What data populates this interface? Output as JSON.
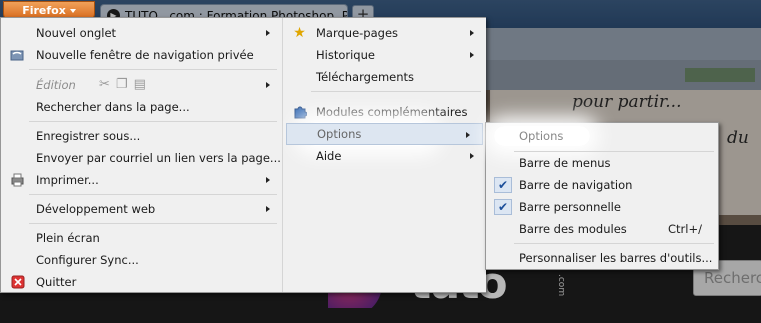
{
  "browser": {
    "app_button": "Firefox",
    "tab_title": "TUTO . com : Formation Photoshop, PH...",
    "new_tab": "+"
  },
  "background": {
    "handwritten_1": "pour partir...",
    "handwritten_2": "du",
    "logo_text": "tuto",
    "logo_vertical": ".com",
    "search_placeholder": "Recherc"
  },
  "menu": {
    "left": [
      {
        "label": "Nouvel onglet",
        "submenu": true
      },
      {
        "label": "Nouvelle fenêtre de navigation privée",
        "icon": "private-window-icon"
      },
      {
        "label": "Édition",
        "submenu": true,
        "disabled": true
      },
      {
        "label": "Rechercher dans la page..."
      },
      {
        "label": "Enregistrer sous..."
      },
      {
        "label": "Envoyer par courriel un lien vers la page..."
      },
      {
        "label": "Imprimer...",
        "submenu": true,
        "icon": "printer-icon"
      },
      {
        "label": "Développement web",
        "submenu": true
      },
      {
        "label": "Plein écran"
      },
      {
        "label": "Configurer Sync..."
      },
      {
        "label": "Quitter",
        "icon": "quit-icon"
      }
    ],
    "right": [
      {
        "label": "Marque-pages",
        "submenu": true,
        "icon": "star-icon"
      },
      {
        "label": "Historique",
        "submenu": true
      },
      {
        "label": "Téléchargements"
      },
      {
        "label": "Modules complémentaires",
        "icon": "puzzle-icon"
      },
      {
        "label": "Options",
        "submenu": true,
        "highlighted": true
      },
      {
        "label": "Aide",
        "submenu": true
      }
    ]
  },
  "submenu": {
    "items": [
      {
        "label": "Options"
      },
      {
        "label": "Barre de menus",
        "checked": false
      },
      {
        "label": "Barre de navigation",
        "checked": true
      },
      {
        "label": "Barre personnelle",
        "checked": true
      },
      {
        "label": "Barre des modules",
        "checked": false,
        "shortcut": "Ctrl+/"
      },
      {
        "label": "Personnaliser les barres d'outils..."
      }
    ]
  },
  "colors": {
    "firefox_orange": "#e07a2e",
    "menu_bg": "#f0f0f0",
    "highlight": "#dde6f1",
    "check_blue": "#1d4f9a"
  }
}
